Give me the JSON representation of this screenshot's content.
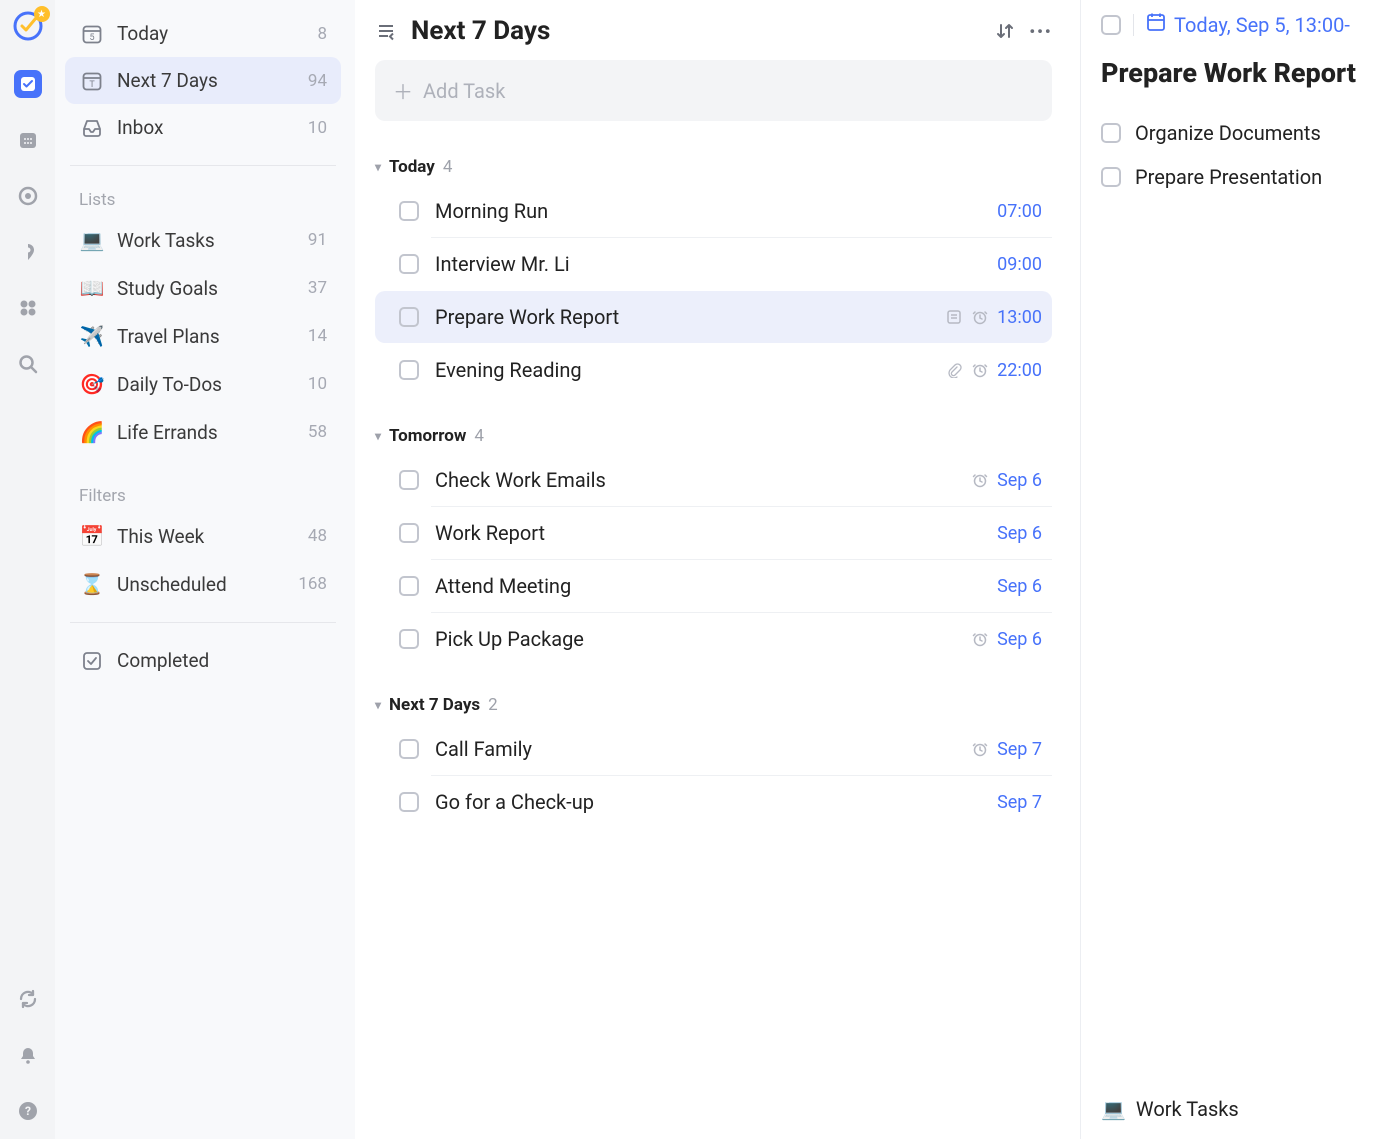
{
  "rail": {
    "badge": "👑"
  },
  "sidebar": {
    "smart": [
      {
        "icon": "today",
        "label": "Today",
        "count": "8",
        "selected": false
      },
      {
        "icon": "7days",
        "label": "Next 7 Days",
        "count": "94",
        "selected": true
      },
      {
        "icon": "inbox",
        "label": "Inbox",
        "count": "10",
        "selected": false
      }
    ],
    "lists_heading": "Lists",
    "lists": [
      {
        "emoji": "💻",
        "label": "Work Tasks",
        "count": "91"
      },
      {
        "emoji": "📖",
        "label": "Study Goals",
        "count": "37"
      },
      {
        "emoji": "✈️",
        "label": "Travel Plans",
        "count": "14"
      },
      {
        "emoji": "🎯",
        "label": "Daily To-Dos",
        "count": "10"
      },
      {
        "emoji": "🌈",
        "label": "Life Errands",
        "count": "58"
      }
    ],
    "filters_heading": "Filters",
    "filters": [
      {
        "emoji": "📅",
        "label": "This Week",
        "count": "48"
      },
      {
        "emoji": "⌛",
        "label": "Unscheduled",
        "count": "168"
      }
    ],
    "completed_label": "Completed"
  },
  "main": {
    "title": "Next 7 Days",
    "add_placeholder": "Add Task",
    "groups": [
      {
        "name": "Today",
        "count": "4",
        "tasks": [
          {
            "title": "Morning Run",
            "time": "07:00",
            "icons": [],
            "selected": false
          },
          {
            "title": "Interview Mr. Li",
            "time": "09:00",
            "icons": [],
            "selected": false
          },
          {
            "title": "Prepare Work Report",
            "time": "13:00",
            "icons": [
              "note",
              "alarm"
            ],
            "selected": true
          },
          {
            "title": "Evening Reading",
            "time": "22:00",
            "icons": [
              "clip",
              "alarm"
            ],
            "selected": false
          }
        ]
      },
      {
        "name": "Tomorrow",
        "count": "4",
        "tasks": [
          {
            "title": "Check Work Emails",
            "time": "Sep 6",
            "icons": [
              "alarm"
            ],
            "selected": false
          },
          {
            "title": "Work Report",
            "time": "Sep 6",
            "icons": [],
            "selected": false
          },
          {
            "title": "Attend Meeting",
            "time": "Sep 6",
            "icons": [],
            "selected": false
          },
          {
            "title": "Pick Up Package",
            "time": "Sep 6",
            "icons": [
              "alarm"
            ],
            "selected": false
          }
        ]
      },
      {
        "name": "Next 7 Days",
        "count": "2",
        "tasks": [
          {
            "title": "Call Family",
            "time": "Sep 7",
            "icons": [
              "alarm"
            ],
            "selected": false
          },
          {
            "title": "Go for a Check-up",
            "time": "Sep 7",
            "icons": [],
            "selected": false
          }
        ]
      }
    ]
  },
  "detail": {
    "date_label": "Today, Sep 5, 13:00-",
    "title": "Prepare Work Report",
    "subtasks": [
      {
        "label": "Organize Documents"
      },
      {
        "label": "Prepare Presentation"
      }
    ],
    "list_emoji": "💻",
    "list_label": "Work Tasks"
  }
}
